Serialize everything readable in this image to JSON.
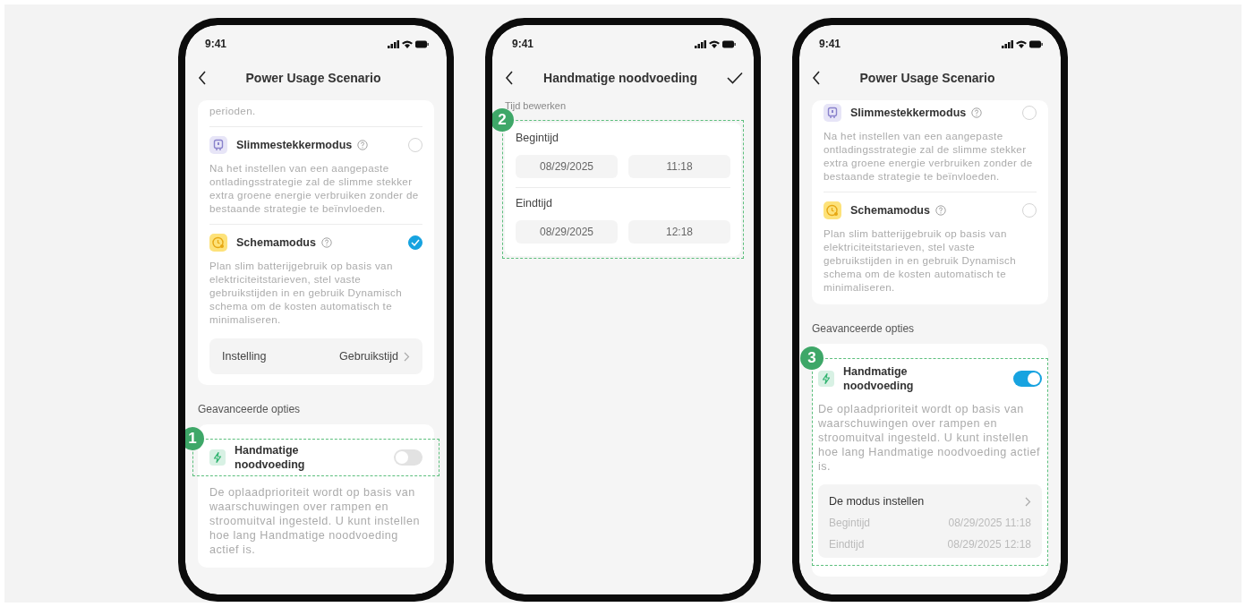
{
  "phones": [
    {
      "kind": "list",
      "time": "9:41",
      "title": "Power Usage Scenario",
      "blocks": [
        {
          "kind": "modes",
          "items": [
            {
              "kind": "text",
              "text": "perioden."
            },
            {
              "kind": "smartplug",
              "label": "Slimmestekkermodus",
              "description": "Na het instellen van een aangepaste ontladingsstrategie zal de slimme stekker extra groene energie verbruiken zonder de bestaande strategie te beïnvloeden.",
              "selected": false
            },
            {
              "kind": "schedule",
              "label": "Schemamodus",
              "description": "Plan slim batterijgebruik op basis van elektriciteitstarieven, stel vaste gebruikstijden in en gebruik Dynamisch schema om de kosten automatisch te minimaliseren.",
              "selected": true,
              "setting": {
                "label": "Instelling",
                "value": "Gebruikstijd"
              }
            }
          ]
        },
        {
          "kind": "heading",
          "text": "Geavanceerde opties"
        },
        {
          "kind": "emergency",
          "callout": "1",
          "title": "Handmatige noodvoeding",
          "on": false,
          "description": "De oplaadprioriteit wordt op basis van waarschuwingen over rampen en stroomuitval ingesteld. U kunt instellen hoe lang Handmatige noodvoeding actief is."
        }
      ]
    },
    {
      "kind": "edit",
      "time": "9:41",
      "title": "Handmatige noodvoeding",
      "blocks": [
        {
          "kind": "heading",
          "text": "Tijd bewerken"
        },
        {
          "kind": "time_edit",
          "callout": "2",
          "groups": [
            {
              "label": "Begintijd",
              "date": "08/29/2025",
              "time": "11:18"
            },
            {
              "label": "Eindtijd",
              "date": "08/29/2025",
              "time": "12:18"
            }
          ]
        }
      ]
    },
    {
      "kind": "list",
      "time": "9:41",
      "title": "Power Usage Scenario",
      "blocks": [
        {
          "kind": "modes",
          "items": [
            {
              "kind": "smartplug",
              "label": "Slimmestekkermodus",
              "description": "Na het instellen van een aangepaste ontladingsstrategie zal de slimme stekker extra groene energie verbruiken zonder de bestaande strategie te beïnvloeden.",
              "selected": false
            },
            {
              "kind": "schedule",
              "label": "Schemamodus",
              "description": "Plan slim batterijgebruik op basis van elektriciteitstarieven, stel vaste gebruikstijden in en gebruik Dynamisch schema om de kosten automatisch te minimaliseren.",
              "selected": false
            }
          ]
        },
        {
          "kind": "heading",
          "text": "Geavanceerde opties"
        },
        {
          "kind": "emergency",
          "callout": "3",
          "title": "Handmatige noodvoeding",
          "on": true,
          "description": "De oplaadprioriteit wordt op basis van waarschuwingen over rampen en stroomuitval ingesteld. U kunt instellen hoe lang Handmatige noodvoeding actief is.",
          "detail": {
            "title": "De modus instellen",
            "rows": [
              {
                "label": "Begintijd",
                "value": "08/29/2025 11:18"
              },
              {
                "label": "Eindtijd",
                "value": "08/29/2025 12:18"
              }
            ]
          }
        }
      ]
    }
  ]
}
